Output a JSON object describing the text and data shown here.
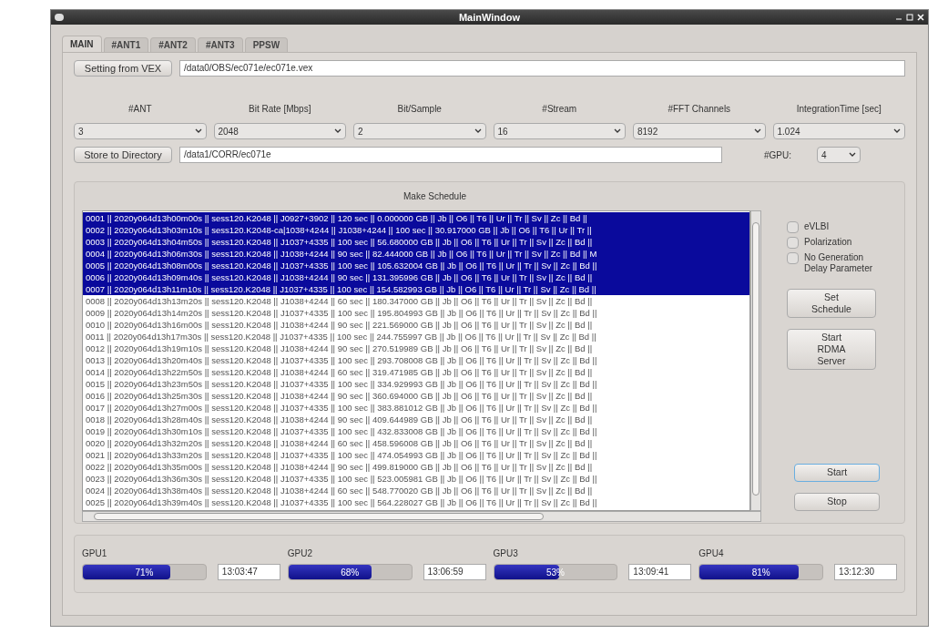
{
  "window": {
    "title": "MainWindow"
  },
  "tabs": [
    {
      "label": "MAIN",
      "selected": true
    },
    {
      "label": "#ANT1",
      "selected": false
    },
    {
      "label": "#ANT2",
      "selected": false
    },
    {
      "label": "#ANT3",
      "selected": false
    },
    {
      "label": "PPSW",
      "selected": false
    }
  ],
  "vex": {
    "button": "Setting from VEX",
    "path": "/data0/OBS/ec071e/ec071e.vex"
  },
  "settings": [
    {
      "label": "#ANT",
      "value": "3"
    },
    {
      "label": "Bit Rate [Mbps]",
      "value": "2048"
    },
    {
      "label": "Bit/Sample",
      "value": "2"
    },
    {
      "label": "#Stream",
      "value": "16"
    },
    {
      "label": "#FFT Channels",
      "value": "8192"
    },
    {
      "label": "IntegrationTime [sec]",
      "value": "1.024"
    }
  ],
  "store": {
    "button": "Store to Directory",
    "path": "/data1/CORR/ec071e",
    "gpu_label": "#GPU:",
    "gpu_value": "4"
  },
  "schedule": {
    "title": "Make Schedule",
    "rows": [
      {
        "text": "0001 || 2020y064d13h00m00s || sess120.K2048 || J0927+3902 || 120 sec || 0.000000 GB || Jb || O6 || T6 || Ur || Tr || Sv || Zc || Bd ||",
        "selected": true
      },
      {
        "text": "0002 || 2020y064d13h03m10s || sess120.K2048-ca|1038+4244 || J1038+4244 || 100 sec || 30.917000 GB || Jb || O6 || T6 || Ur || Tr ||",
        "selected": true
      },
      {
        "text": "0003 || 2020y064d13h04m50s || sess120.K2048 || J1037+4335 || 100 sec || 56.680000 GB || Jb || O6 || T6 || Ur || Tr || Sv || Zc || Bd ||",
        "selected": true
      },
      {
        "text": "0004 || 2020y064d13h06m30s || sess120.K2048 || J1038+4244 || 90 sec || 82.444000 GB || Jb || O6 || T6 || Ur || Tr || Sv || Zc || Bd || M",
        "selected": true
      },
      {
        "text": "0005 || 2020y064d13h08m00s || sess120.K2048 || J1037+4335 || 100 sec || 105.632004 GB || Jb || O6 || T6 || Ur || Tr || Sv || Zc || Bd ||",
        "selected": true
      },
      {
        "text": "0006 || 2020y064d13h09m40s || sess120.K2048 || J1038+4244 || 90 sec || 131.395996 GB || Jb || O6 || T6 || Ur || Tr || Sv || Zc || Bd ||",
        "selected": true
      },
      {
        "text": "0007 || 2020y064d13h11m10s || sess120.K2048 || J1037+4335 || 100 sec || 154.582993 GB || Jb || O6 || T6 || Ur || Tr || Sv || Zc || Bd ||",
        "selected": true
      },
      {
        "text": "0008 || 2020y064d13h13m20s || sess120.K2048 || J1038+4244 || 60 sec || 180.347000 GB || Jb || O6 || T6 || Ur || Tr || Sv || Zc || Bd ||",
        "selected": false
      },
      {
        "text": "0009 || 2020y064d13h14m20s || sess120.K2048 || J1037+4335 || 100 sec || 195.804993 GB || Jb || O6 || T6 || Ur || Tr || Sv || Zc || Bd ||",
        "selected": false
      },
      {
        "text": "0010 || 2020y064d13h16m00s || sess120.K2048 || J1038+4244 || 90 sec || 221.569000 GB || Jb || O6 || T6 || Ur || Tr || Sv || Zc || Bd ||",
        "selected": false
      },
      {
        "text": "0011 || 2020y064d13h17m30s || sess120.K2048 || J1037+4335 || 100 sec || 244.755997 GB || Jb || O6 || T6 || Ur || Tr || Sv || Zc || Bd ||",
        "selected": false
      },
      {
        "text": "0012 || 2020y064d13h19m10s || sess120.K2048 || J1038+4244 || 90 sec || 270.519989 GB || Jb || O6 || T6 || Ur || Tr || Sv || Zc || Bd ||",
        "selected": false
      },
      {
        "text": "0013 || 2020y064d13h20m40s || sess120.K2048 || J1037+4335 || 100 sec || 293.708008 GB || Jb || O6 || T6 || Ur || Tr || Sv || Zc || Bd ||",
        "selected": false
      },
      {
        "text": "0014 || 2020y064d13h22m50s || sess120.K2048 || J1038+4244 || 60 sec || 319.471985 GB || Jb || O6 || T6 || Ur || Tr || Sv || Zc || Bd ||",
        "selected": false
      },
      {
        "text": "0015 || 2020y064d13h23m50s || sess120.K2048 || J1037+4335 || 100 sec || 334.929993 GB || Jb || O6 || T6 || Ur || Tr || Sv || Zc || Bd ||",
        "selected": false
      },
      {
        "text": "0016 || 2020y064d13h25m30s || sess120.K2048 || J1038+4244 || 90 sec || 360.694000 GB || Jb || O6 || T6 || Ur || Tr || Sv || Zc || Bd ||",
        "selected": false
      },
      {
        "text": "0017 || 2020y064d13h27m00s || sess120.K2048 || J1037+4335 || 100 sec || 383.881012 GB || Jb || O6 || T6 || Ur || Tr || Sv || Zc || Bd ||",
        "selected": false
      },
      {
        "text": "0018 || 2020y064d13h28m40s || sess120.K2048 || J1038+4244 || 90 sec || 409.644989 GB || Jb || O6 || T6 || Ur || Tr || Sv || Zc || Bd ||",
        "selected": false
      },
      {
        "text": "0019 || 2020y064d13h30m10s || sess120.K2048 || J1037+4335 || 100 sec || 432.833008 GB || Jb || O6 || T6 || Ur || Tr || Sv || Zc || Bd ||",
        "selected": false
      },
      {
        "text": "0020 || 2020y064d13h32m20s || sess120.K2048 || J1038+4244 || 60 sec || 458.596008 GB || Jb || O6 || T6 || Ur || Tr || Sv || Zc || Bd ||",
        "selected": false
      },
      {
        "text": "0021 || 2020y064d13h33m20s || sess120.K2048 || J1037+4335 || 100 sec || 474.054993 GB || Jb || O6 || T6 || Ur || Tr || Sv || Zc || Bd ||",
        "selected": false
      },
      {
        "text": "0022 || 2020y064d13h35m00s || sess120.K2048 || J1038+4244 || 90 sec || 499.819000 GB || Jb || O6 || T6 || Ur || Tr || Sv || Zc || Bd ||",
        "selected": false
      },
      {
        "text": "0023 || 2020y064d13h36m30s || sess120.K2048 || J1037+4335 || 100 sec || 523.005981 GB || Jb || O6 || T6 || Ur || Tr || Sv || Zc || Bd ||",
        "selected": false
      },
      {
        "text": "0024 || 2020y064d13h38m40s || sess120.K2048 || J1038+4244 || 60 sec || 548.770020 GB || Jb || O6 || T6 || Ur || Tr || Sv || Zc || Bd ||",
        "selected": false
      },
      {
        "text": "0025 || 2020y064d13h39m40s || sess120.K2048 || J1037+4335 || 100 sec || 564.228027 GB || Jb || O6 || T6 || Ur || Tr || Sv || Zc || Bd ||",
        "selected": false
      }
    ]
  },
  "options": [
    {
      "label": "eVLBI",
      "checked": false
    },
    {
      "label": "Polarization",
      "checked": false
    },
    {
      "label": "No Generation Delay Parameter",
      "checked": false
    }
  ],
  "side_buttons": [
    "Set Schedule",
    "Start RDMA Server"
  ],
  "run_buttons": [
    {
      "label": "Start",
      "focused": true
    },
    {
      "label": "Stop",
      "focused": false
    }
  ],
  "gpus": [
    {
      "label": "GPU1",
      "level": 0.71,
      "percent": "71%",
      "time": "13:03:47"
    },
    {
      "label": "GPU2",
      "level": 0.68,
      "percent": "68%",
      "time": "13:06:59"
    },
    {
      "label": "GPU3",
      "level": 0.53,
      "percent": "53%",
      "time": "13:09:41"
    },
    {
      "label": "GPU4",
      "level": 0.81,
      "percent": "81%",
      "time": "13:12:30"
    }
  ]
}
